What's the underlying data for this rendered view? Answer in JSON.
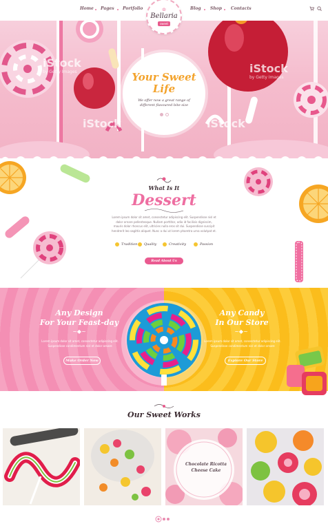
{
  "nav": {
    "left": [
      "Home",
      "Pages",
      "Portfolio"
    ],
    "right": [
      "Blog",
      "Shop",
      "Contacts"
    ]
  },
  "logo": {
    "name": "Bellaria",
    "tag": "sweet"
  },
  "hero": {
    "title": "Your Sweet Life",
    "subtitle": "We offer now a great range of different flavoured bite-size",
    "watermark": "iStock",
    "watermark_sub": "by Getty Images"
  },
  "dessert": {
    "kicker": "What Is It",
    "title": "Dessert",
    "text": "Lorem ipsum dolor sit amet, consectetur adipiscing elit. Suspendisse nisl et dolor ornare pellentesque. Nullam porttitor, odio id facilisis dignissim, mauris dolor rhoncus elit, ultricies nulla eros sit dui. Suspendisse suscipit hendrerit leo sagittis aliquet. Nunc a dui ut lorem pharetra urna volutpat et.",
    "features": [
      "Tradition",
      "Quality",
      "Creativity",
      "Passion"
    ],
    "button": "Read About Us"
  },
  "split": {
    "left_title_1": "Any Design",
    "left_title_2": "For Your Feast-day",
    "left_text": "Lorem ipsum dolor sit amet, consectetur adipiscing elit. Suspendisse condimentum nisl et dolor ornare",
    "left_button": "Make Order Now",
    "right_title_1": "Any Candy",
    "right_title_2": "In Our Store",
    "right_text": "Lorem ipsum dolor sit amet, consectetur adipiscing elit. Suspendisse condimentum nisl et dolor ornare",
    "right_button": "Explore Our Store"
  },
  "works": {
    "title": "Our Sweet Works",
    "caption": "Chocolate Ricotta Cheese Cake"
  },
  "colors": {
    "pink": "#ea5a90",
    "yellow": "#fbbd1c",
    "gold": "#f3a32c"
  }
}
